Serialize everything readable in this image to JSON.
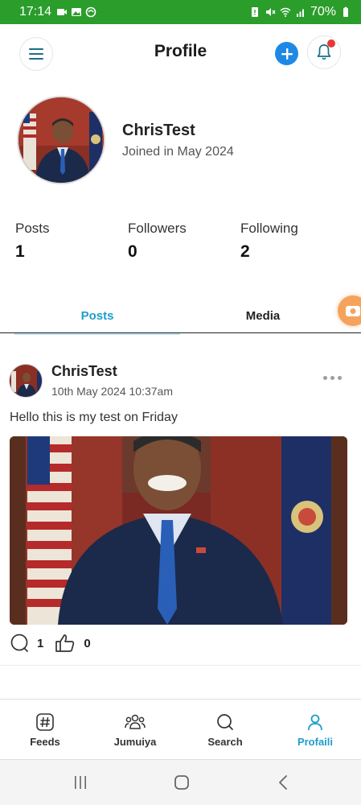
{
  "status_bar": {
    "time": "17:14",
    "battery": "70%"
  },
  "header": {
    "title": "Profile",
    "menu_icon": "hamburger-menu-icon",
    "add_icon": "plus-circle-icon",
    "notification_icon": "bell-icon",
    "has_notification_badge": true
  },
  "profile": {
    "name": "ChrisTest",
    "joined": "Joined in May 2024",
    "avatar": "profile-photo"
  },
  "stats": [
    {
      "label": "Posts",
      "value": "1"
    },
    {
      "label": "Followers",
      "value": "0"
    },
    {
      "label": "Following",
      "value": "2"
    }
  ],
  "tabs": [
    {
      "label": "Posts",
      "active": true
    },
    {
      "label": "Media",
      "active": false
    }
  ],
  "post": {
    "author": "ChrisTest",
    "timestamp": "10th May 2024 10:37am",
    "text": "Hello this is my test on Friday",
    "comments": "1",
    "likes": "0"
  },
  "bottom_nav": [
    {
      "label": "Feeds",
      "icon": "hashtag-icon",
      "active": false
    },
    {
      "label": "Jumuiya",
      "icon": "group-icon",
      "active": false
    },
    {
      "label": "Search",
      "icon": "search-icon",
      "active": false
    },
    {
      "label": "Profaili",
      "icon": "person-icon",
      "active": true
    }
  ],
  "colors": {
    "accent": "#1e9ec9",
    "status_bar": "#2a9d2a",
    "add_button": "#1e88e5",
    "badge": "#e53935",
    "floating_button": "#f5a35c"
  }
}
